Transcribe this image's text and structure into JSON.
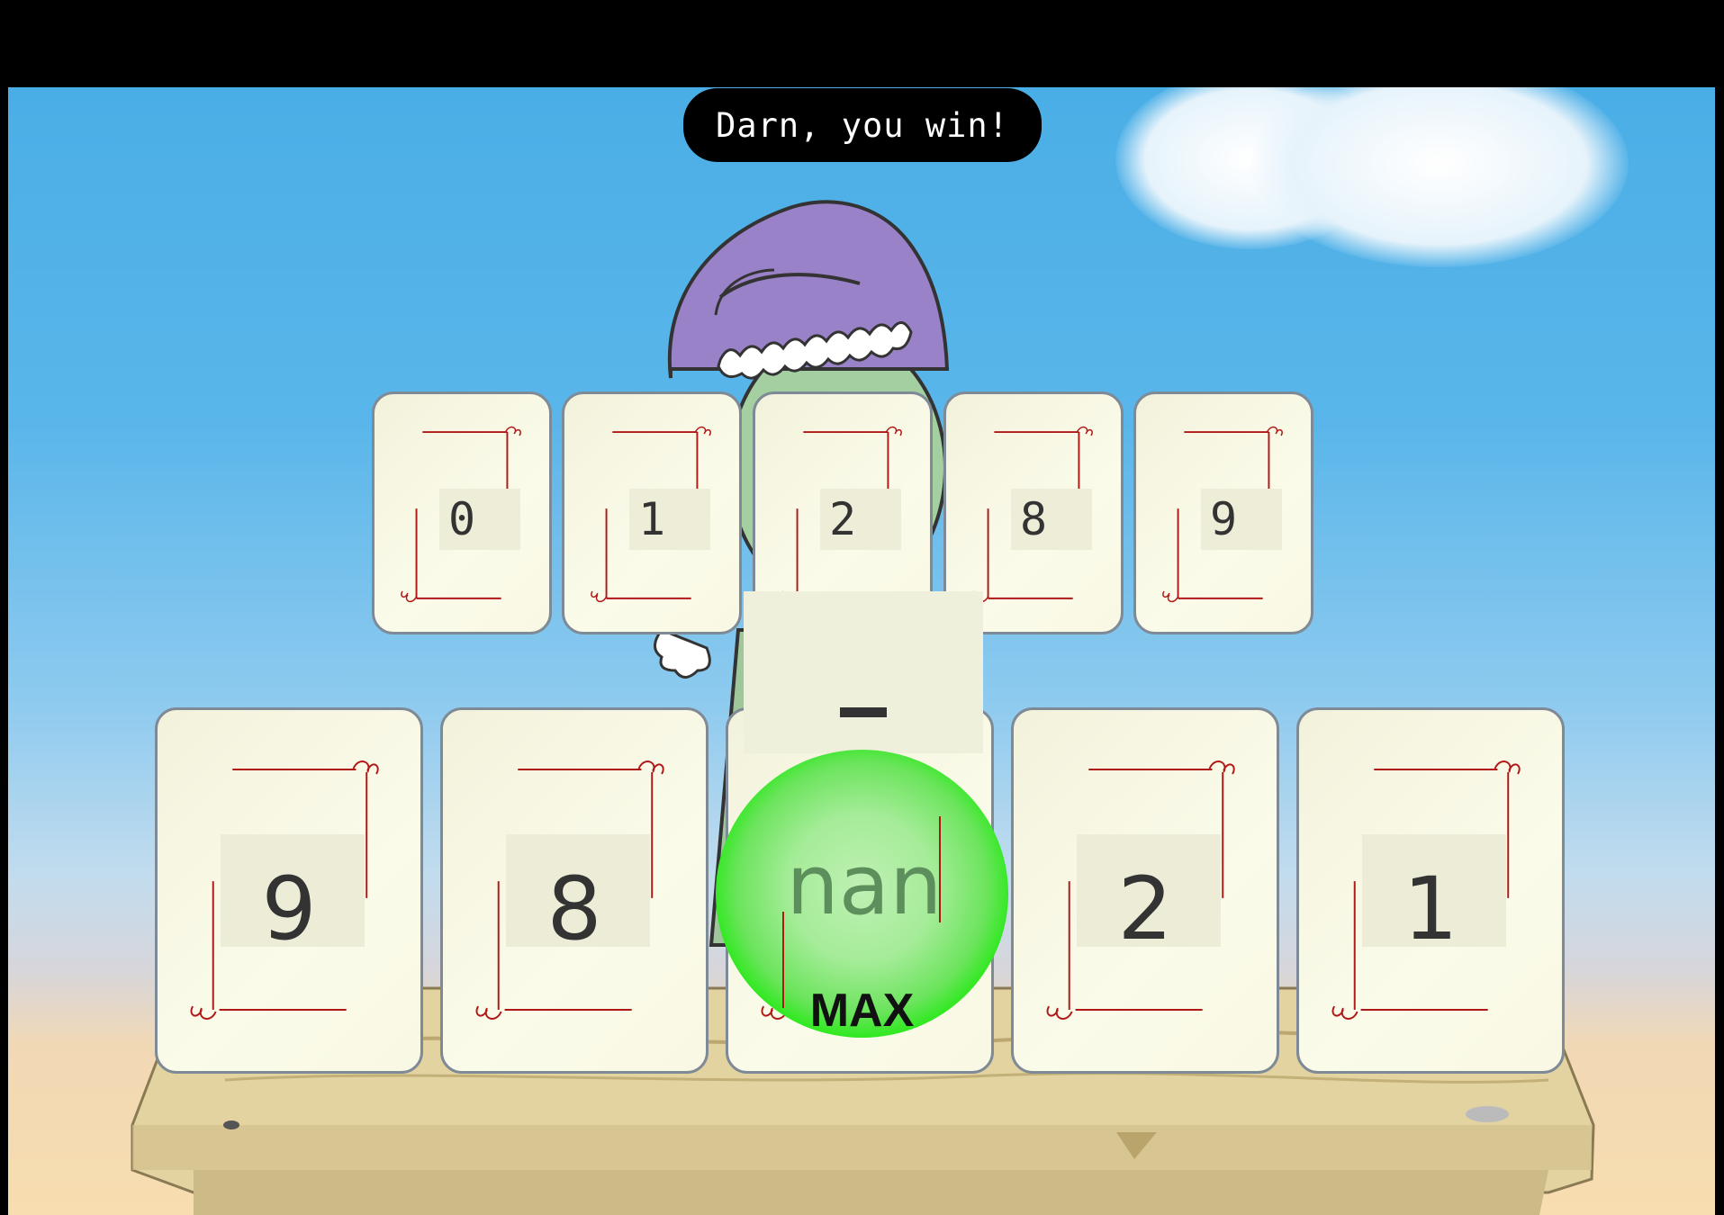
{
  "message": {
    "text": "Darn, you win!"
  },
  "top_row": [
    {
      "value": "0"
    },
    {
      "value": "1"
    },
    {
      "value": "2"
    },
    {
      "value": "8"
    },
    {
      "value": "9"
    }
  ],
  "bottom_row": [
    {
      "value": "9"
    },
    {
      "value": "8"
    },
    {
      "value": "nan"
    },
    {
      "value": "2"
    },
    {
      "value": "1"
    }
  ],
  "selected": {
    "operator": "–",
    "value": "nan",
    "badge": "MAX"
  },
  "colors": {
    "sky": "#4aaee6",
    "card": "#f8f8e4",
    "glow": "#15ee00",
    "hat": "#9a82c8",
    "trim": "#b01818"
  }
}
